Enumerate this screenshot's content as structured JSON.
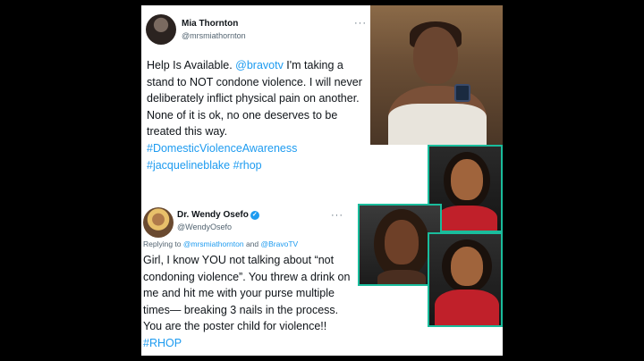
{
  "tweet1": {
    "author": "Mia Thornton",
    "handle": "@mrsmiathornton",
    "more": "···",
    "body_intro": "Help Is Available. ",
    "mention": "@bravotv",
    "body_main": " I'm taking a stand to NOT condone violence. I will never deliberately inflict physical pain on another. None of it is ok, no one deserves to be treated this way. ",
    "hashtag1": "#DomesticViolenceAwareness",
    "hashtag2": "#jacquelineblake",
    "hashtag3": "#rhop"
  },
  "tweet2": {
    "author": "Dr. Wendy Osefo",
    "verified_icon": "✓",
    "handle": "@WendyOsefo",
    "more": "···",
    "reply_prefix": "Replying to ",
    "reply_mention1": "@mrsmiathornton",
    "reply_and": " and ",
    "reply_mention2": "@BravoTV",
    "body": "Girl, I know YOU not talking about “not condoning violence”. You threw a drink on me and hit me with your purse multiple times— breaking 3 nails in the process. You are the poster child for violence!! ",
    "hashtag": "#RHOP"
  },
  "colors": {
    "link": "#1d9bf0",
    "portrait_border": "#1abc9c",
    "background": "#000000"
  },
  "icons": {
    "avatar1": "avatar-photo-icon",
    "avatar2": "avatar-photo-icon",
    "verified": "verified-badge-icon",
    "more": "more-options-icon"
  }
}
